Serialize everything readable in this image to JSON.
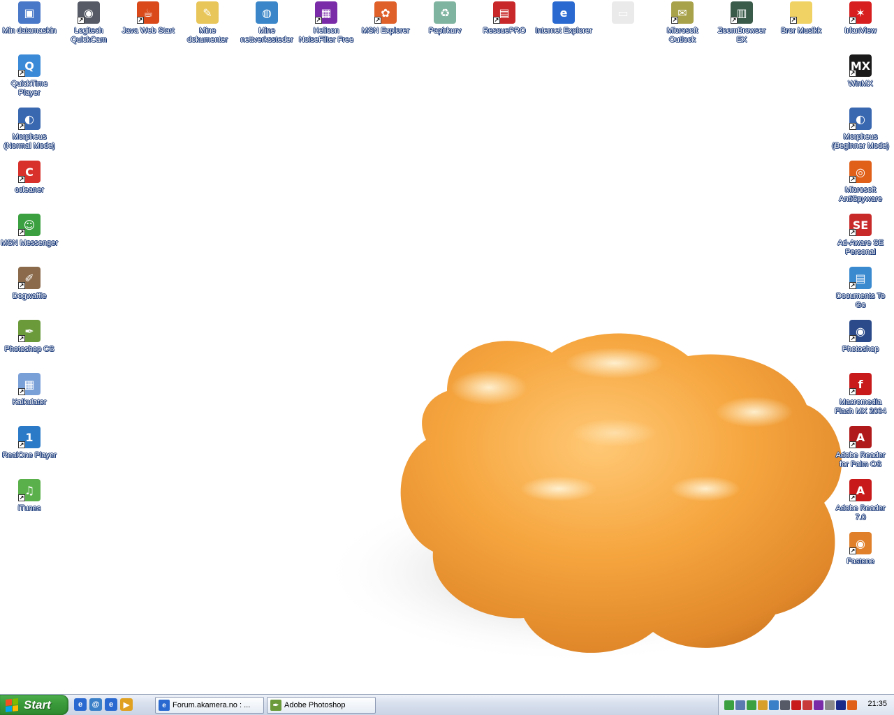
{
  "desktop": {
    "top_icons": [
      {
        "label": "Min datamaskin",
        "icon": "my-computer-icon",
        "color": "#4a78c8",
        "glyph": "▣",
        "shortcut": false
      },
      {
        "label": "Logitech QuickCam",
        "icon": "webcam-icon",
        "color": "#555a66",
        "glyph": "◉",
        "shortcut": true
      },
      {
        "label": "Java Web Start",
        "icon": "java-icon",
        "color": "#d9491a",
        "glyph": "☕",
        "shortcut": true
      },
      {
        "label": "Mine dokumenter",
        "icon": "folder-documents-icon",
        "color": "#e8c65a",
        "glyph": "✎",
        "shortcut": false
      },
      {
        "label": "Mine nettverkssteder",
        "icon": "network-places-icon",
        "color": "#3a86c8",
        "glyph": "◍",
        "shortcut": false
      },
      {
        "label": "Helicon NoiseFilter Free",
        "icon": "helicon-icon",
        "color": "#7a2ca8",
        "glyph": "▦",
        "shortcut": true
      },
      {
        "label": "MSN Explorer",
        "icon": "msn-butterfly-icon",
        "color": "#e0602a",
        "glyph": "✿",
        "shortcut": true
      },
      {
        "label": "Papirkurv",
        "icon": "recycle-bin-icon",
        "color": "#7fb4a0",
        "glyph": "♻",
        "shortcut": false
      },
      {
        "label": "RescuePRO",
        "icon": "rescuepro-icon",
        "color": "#c8282a",
        "glyph": "▤",
        "shortcut": true
      },
      {
        "label": "Internet Explorer",
        "icon": "internet-explorer-icon",
        "color": "#2a6ad0",
        "glyph": "e",
        "shortcut": false
      },
      {
        "label": "",
        "icon": "blank-document-icon",
        "color": "#eaeaea",
        "glyph": "▭",
        "shortcut": false
      },
      {
        "label": "Microsoft Outlook",
        "icon": "outlook-icon",
        "color": "#a8a24a",
        "glyph": "✉",
        "shortcut": true
      },
      {
        "label": "ZoomBrowser EX",
        "icon": "zoombrowser-icon",
        "color": "#3a5a4a",
        "glyph": "▥",
        "shortcut": true
      },
      {
        "label": "Bror Musikk",
        "icon": "folder-icon",
        "color": "#f0d264",
        "glyph": "",
        "shortcut": true
      },
      {
        "label": "IrfanView",
        "icon": "irfanview-icon",
        "color": "#d81f1f",
        "glyph": "✶",
        "shortcut": true
      }
    ],
    "left_icons": [
      {
        "label": "QuickTime Player",
        "icon": "quicktime-icon",
        "color": "#3a8ad8",
        "glyph": "Q",
        "shortcut": true
      },
      {
        "label": "Morpheus (Normal Mode)",
        "icon": "morpheus-icon",
        "color": "#3a68b0",
        "glyph": "◐",
        "shortcut": true
      },
      {
        "label": "ccleaner",
        "icon": "ccleaner-icon",
        "color": "#d8302a",
        "glyph": "C",
        "shortcut": true
      },
      {
        "label": "MSN Messenger",
        "icon": "msn-messenger-icon",
        "color": "#3aa040",
        "glyph": "☺",
        "shortcut": true
      },
      {
        "label": "Dogwaffle",
        "icon": "dogwaffle-icon",
        "color": "#8a6a4a",
        "glyph": "✐",
        "shortcut": true
      },
      {
        "label": "Photoshop CS",
        "icon": "photoshop-cs-icon",
        "color": "#6a9a3a",
        "glyph": "✒",
        "shortcut": true
      },
      {
        "label": "Kalkulator",
        "icon": "calculator-icon",
        "color": "#7aa0d8",
        "glyph": "▦",
        "shortcut": true
      },
      {
        "label": "RealOne Player",
        "icon": "realone-icon",
        "color": "#2a7ac8",
        "glyph": "1",
        "shortcut": true
      },
      {
        "label": "iTunes",
        "icon": "itunes-icon",
        "color": "#5ab04a",
        "glyph": "♫",
        "shortcut": true
      }
    ],
    "right_icons": [
      {
        "label": "WinMX",
        "icon": "winmx-icon",
        "color": "#1a1a1a",
        "glyph": "MX",
        "shortcut": true
      },
      {
        "label": "Morpheus (Beginner Mode)",
        "icon": "morpheus-icon",
        "color": "#3a68b0",
        "glyph": "◐",
        "shortcut": true
      },
      {
        "label": "Microsoft AntiSpyware",
        "icon": "antispyware-icon",
        "color": "#e0601a",
        "glyph": "◎",
        "shortcut": true
      },
      {
        "label": "Ad-Aware SE Personal",
        "icon": "adaware-icon",
        "color": "#c82a2a",
        "glyph": "SE",
        "shortcut": true
      },
      {
        "label": "Documents To Go",
        "icon": "documents-to-go-icon",
        "color": "#3a8ad0",
        "glyph": "▤",
        "shortcut": true
      },
      {
        "label": "Photoshop",
        "icon": "photoshop-icon",
        "color": "#2a4a8a",
        "glyph": "◉",
        "shortcut": true
      },
      {
        "label": "Macromedia Flash MX 2004",
        "icon": "flash-icon",
        "color": "#c81a1a",
        "glyph": "f",
        "shortcut": true
      },
      {
        "label": "Adobe Reader for Palm OS",
        "icon": "adobe-reader-palm-icon",
        "color": "#b01a1a",
        "glyph": "A",
        "shortcut": true
      },
      {
        "label": "Adobe Reader 7.0",
        "icon": "adobe-reader-icon",
        "color": "#c81a1a",
        "glyph": "A",
        "shortcut": true
      },
      {
        "label": "Fastone",
        "icon": "fastone-icon",
        "color": "#e0802a",
        "glyph": "◉",
        "shortcut": true
      }
    ]
  },
  "taskbar": {
    "start_label": "Start",
    "quick_launch": [
      {
        "icon": "ie-quicklaunch-icon",
        "color": "#2a6ad0",
        "glyph": "e"
      },
      {
        "icon": "outlook-express-quicklaunch-icon",
        "color": "#3a80c8",
        "glyph": "@"
      },
      {
        "icon": "ie-quicklaunch-icon-2",
        "color": "#2a6ad0",
        "glyph": "e"
      },
      {
        "icon": "media-player-quicklaunch-icon",
        "color": "#e0a020",
        "glyph": "▶"
      }
    ],
    "tasks": [
      {
        "label": "Forum.akamera.no : ...",
        "icon": "ie-task-icon",
        "color": "#2a6ad0",
        "glyph": "e"
      },
      {
        "label": "Adobe Photoshop",
        "icon": "photoshop-task-icon",
        "color": "#6a9a3a",
        "glyph": "✒"
      }
    ],
    "tray_icons": [
      {
        "icon": "tray-green-icon",
        "color": "#3aa040"
      },
      {
        "icon": "tray-network-icon",
        "color": "#5a7ab0"
      },
      {
        "icon": "tray-messenger-icon",
        "color": "#3aa040"
      },
      {
        "icon": "tray-shield-icon",
        "color": "#d8a02a"
      },
      {
        "icon": "tray-globe-icon",
        "color": "#3a80c8"
      },
      {
        "icon": "tray-webcam-icon",
        "color": "#555a66"
      },
      {
        "icon": "tray-adobe-icon",
        "color": "#c81a1a"
      },
      {
        "icon": "tray-antivirus-icon",
        "color": "#c83a3a"
      },
      {
        "icon": "tray-helicon-icon",
        "color": "#7a2ca8"
      },
      {
        "icon": "tray-speaker-icon",
        "color": "#8a8a8a"
      },
      {
        "icon": "tray-display-icon",
        "color": "#1a2a8a"
      },
      {
        "icon": "tray-antispyware-icon",
        "color": "#e0601a"
      }
    ],
    "clock": "21:35"
  }
}
